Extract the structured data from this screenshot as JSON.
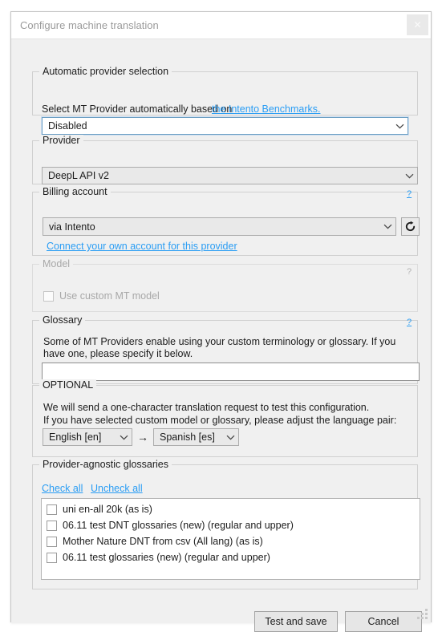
{
  "window": {
    "title": "Configure machine translation",
    "close_label": "✕"
  },
  "auto_provider": {
    "group_title": "Automatic provider selection",
    "label": "Select MT Provider automatically based on",
    "link": "the Intento Benchmarks.",
    "select_value": "Disabled"
  },
  "provider": {
    "group_title": "Provider",
    "select_value": "DeepL API v2"
  },
  "billing": {
    "group_title": "Billing account",
    "help": "?",
    "select_value": "via Intento",
    "refresh_icon": "refresh-icon",
    "connect_link": "Connect your own account for this provider"
  },
  "model": {
    "group_title": "Model",
    "help": "?",
    "checkbox_label": "Use custom MT model",
    "checked": false,
    "disabled": true
  },
  "glossary": {
    "group_title": "Glossary",
    "help": "?",
    "description": "Some of MT Providers enable using your custom terminology or glossary. If you have one, please specify it below.",
    "input_value": "",
    "input_placeholder": ""
  },
  "optional": {
    "group_title": "OPTIONAL",
    "line1": "We will send a one-character translation request to test this configuration.",
    "line2": "If you have selected custom model or glossary, please adjust the language pair:",
    "source_language": "English [en]",
    "arrow": "→",
    "target_language": "Spanish [es]"
  },
  "glossaries": {
    "group_title": "Provider-agnostic glossaries",
    "check_all": "Check all",
    "uncheck_all": "Uncheck all",
    "items": [
      {
        "label": "uni en-all 20k (as is)",
        "checked": false
      },
      {
        "label": "06.11 test DNT glossaries (new) (regular and upper)",
        "checked": false
      },
      {
        "label": "Mother Nature DNT from csv (All lang) (as is)",
        "checked": false
      },
      {
        "label": "06.11 test glossaries (new) (regular and upper)",
        "checked": false
      }
    ]
  },
  "footer": {
    "primary_button": "Test and save",
    "secondary_button": "Cancel"
  },
  "colors": {
    "link": "#2a9df4",
    "window_bg": "#f0f0f0",
    "focus_border": "#6d9fc4"
  }
}
